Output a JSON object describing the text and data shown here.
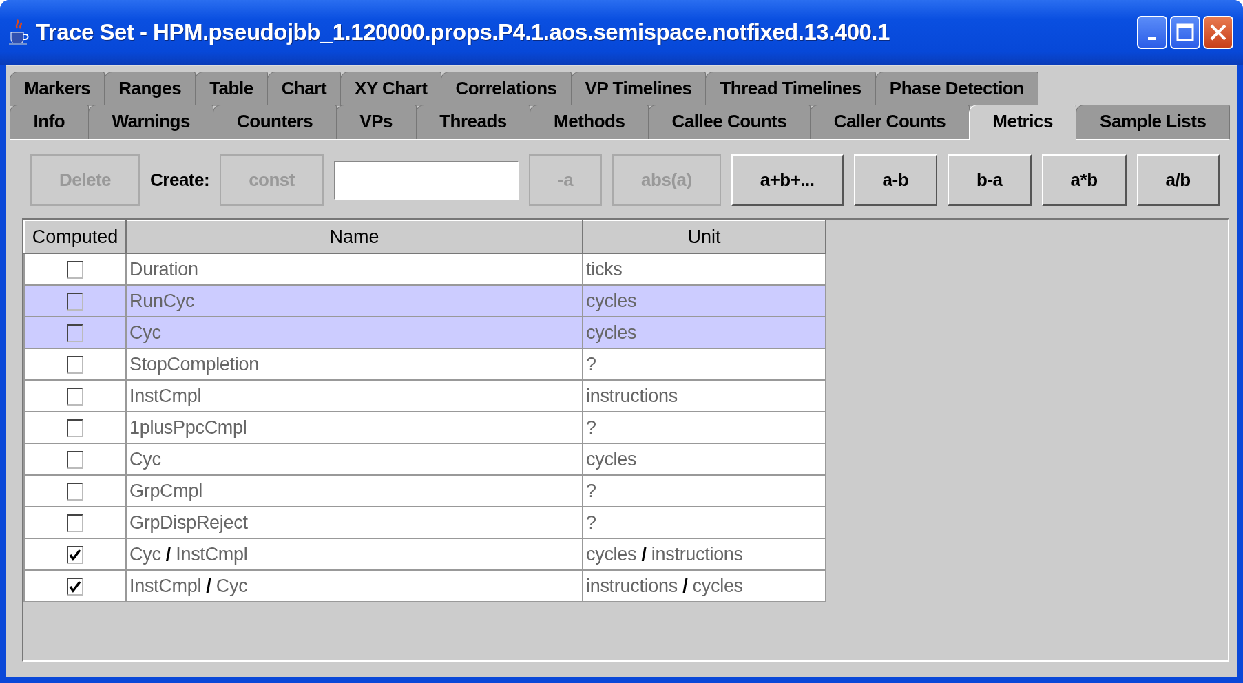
{
  "window": {
    "title": "Trace Set - HPM.pseudojbb_1.120000.props.P4.1.aos.semispace.notfixed.13.400.1"
  },
  "tab_rows": [
    {
      "tabs": [
        {
          "label": "Markers",
          "selected": false
        },
        {
          "label": "Ranges",
          "selected": false
        },
        {
          "label": "Table",
          "selected": false
        },
        {
          "label": "Chart",
          "selected": false
        },
        {
          "label": "XY Chart",
          "selected": false
        },
        {
          "label": "Correlations",
          "selected": false
        },
        {
          "label": "VP Timelines",
          "selected": false
        },
        {
          "label": "Thread Timelines",
          "selected": false
        },
        {
          "label": "Phase Detection",
          "selected": false
        }
      ]
    },
    {
      "tabs": [
        {
          "label": "Info",
          "selected": false
        },
        {
          "label": "Warnings",
          "selected": false
        },
        {
          "label": "Counters",
          "selected": false
        },
        {
          "label": "VPs",
          "selected": false
        },
        {
          "label": "Threads",
          "selected": false
        },
        {
          "label": "Methods",
          "selected": false
        },
        {
          "label": "Callee Counts",
          "selected": false
        },
        {
          "label": "Caller Counts",
          "selected": false
        },
        {
          "label": "Metrics",
          "selected": true
        },
        {
          "label": "Sample Lists",
          "selected": false
        }
      ]
    }
  ],
  "toolbar": [
    {
      "kind": "button",
      "label": "Delete",
      "disabled": true
    },
    {
      "kind": "label",
      "label": "Create:"
    },
    {
      "kind": "button",
      "label": "const",
      "disabled": true
    },
    {
      "kind": "field"
    },
    {
      "kind": "button",
      "label": "-a",
      "disabled": true
    },
    {
      "kind": "button",
      "label": "abs(a)",
      "disabled": true
    },
    {
      "kind": "button",
      "label": "a+b+...",
      "disabled": false
    },
    {
      "kind": "button",
      "label": "a-b",
      "disabled": false
    },
    {
      "kind": "button",
      "label": "b-a",
      "disabled": false
    },
    {
      "kind": "button",
      "label": "a*b",
      "disabled": false
    },
    {
      "kind": "button",
      "label": "a/b",
      "disabled": false
    }
  ],
  "table": {
    "columns": [
      "Computed",
      "Name",
      "Unit"
    ],
    "rows": [
      {
        "computed": false,
        "name": "Duration",
        "unit": "ticks",
        "selected": false
      },
      {
        "computed": false,
        "name": "RunCyc",
        "unit": "cycles",
        "selected": true
      },
      {
        "computed": false,
        "name": "Cyc",
        "unit": "cycles",
        "selected": true
      },
      {
        "computed": false,
        "name": "StopCompletion",
        "unit": "?",
        "selected": false
      },
      {
        "computed": false,
        "name": "InstCmpl",
        "unit": "instructions",
        "selected": false
      },
      {
        "computed": false,
        "name": "1plusPpcCmpl",
        "unit": "?",
        "selected": false
      },
      {
        "computed": false,
        "name": "Cyc",
        "unit": "cycles",
        "selected": false
      },
      {
        "computed": false,
        "name": "GrpCmpl",
        "unit": "?",
        "selected": false
      },
      {
        "computed": false,
        "name": "GrpDispReject",
        "unit": "?",
        "selected": false
      },
      {
        "computed": true,
        "name": "Cyc **/** InstCmpl",
        "unit": "cycles **/** instructions",
        "selected": false
      },
      {
        "computed": true,
        "name": "InstCmpl **/** Cyc",
        "unit": "instructions **/** cycles",
        "selected": false
      }
    ]
  }
}
